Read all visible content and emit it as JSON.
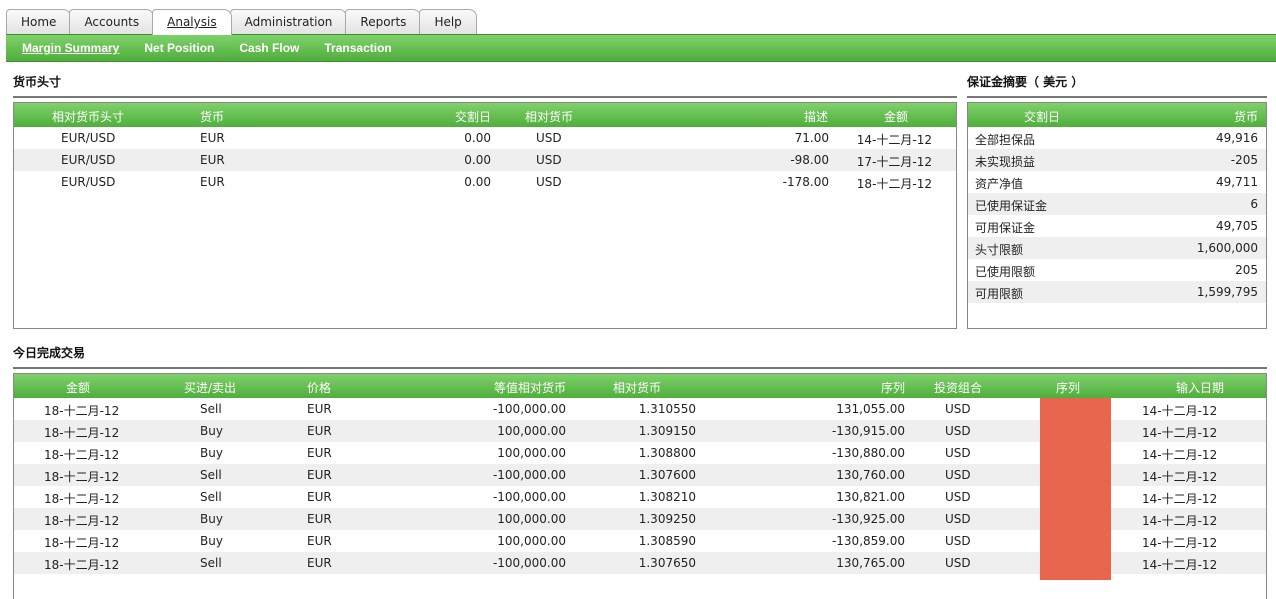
{
  "nav": {
    "tabs": [
      "Home",
      "Accounts",
      "Analysis",
      "Administration",
      "Reports",
      "Help"
    ],
    "active_tab": "Analysis",
    "subtabs": [
      "Margin Summary",
      "Net Position",
      "Cash Flow",
      "Transaction"
    ],
    "active_subtab": "Margin Summary"
  },
  "positions": {
    "title": "货币头寸",
    "headers": [
      "相对货币头寸",
      "货币",
      "交割日",
      "相对货币",
      "描述",
      "金额"
    ],
    "rows": [
      [
        "EUR/USD",
        "EUR",
        "0.00",
        "USD",
        "71.00",
        "14-十二月-12"
      ],
      [
        "EUR/USD",
        "EUR",
        "0.00",
        "USD",
        "-98.00",
        "17-十二月-12"
      ],
      [
        "EUR/USD",
        "EUR",
        "0.00",
        "USD",
        "-178.00",
        "18-十二月-12"
      ]
    ]
  },
  "summary": {
    "title": "保证金摘要（ 美元 ）",
    "headers": [
      "交割日",
      "货币"
    ],
    "rows": [
      [
        "全部担保品",
        "49,916"
      ],
      [
        "未实现损益",
        "-205"
      ],
      [
        "资产净值",
        "49,711"
      ],
      [
        "已使用保证金",
        "6"
      ],
      [
        "可用保证金",
        "49,705"
      ],
      [
        "头寸限额",
        "1,600,000"
      ],
      [
        "已使用限额",
        "205"
      ],
      [
        "可用限额",
        "1,599,795"
      ]
    ]
  },
  "trades": {
    "title": "今日完成交易",
    "headers": [
      "金额",
      "买进/卖出",
      "价格",
      "等值相对货币",
      "相对货币",
      "序列",
      "投资组合",
      "序列",
      "输入日期"
    ],
    "rows": [
      [
        "18-十二月-12",
        "Sell",
        "EUR",
        "-100,000.00",
        "1.310550",
        "131,055.00",
        "USD",
        "14-十二月-12"
      ],
      [
        "18-十二月-12",
        "Buy",
        "EUR",
        "100,000.00",
        "1.309150",
        "-130,915.00",
        "USD",
        "14-十二月-12"
      ],
      [
        "18-十二月-12",
        "Buy",
        "EUR",
        "100,000.00",
        "1.308800",
        "-130,880.00",
        "USD",
        "14-十二月-12"
      ],
      [
        "18-十二月-12",
        "Sell",
        "EUR",
        "-100,000.00",
        "1.307600",
        "130,760.00",
        "USD",
        "14-十二月-12"
      ],
      [
        "18-十二月-12",
        "Sell",
        "EUR",
        "-100,000.00",
        "1.308210",
        "130,821.00",
        "USD",
        "14-十二月-12"
      ],
      [
        "18-十二月-12",
        "Buy",
        "EUR",
        "100,000.00",
        "1.309250",
        "-130,925.00",
        "USD",
        "14-十二月-12"
      ],
      [
        "18-十二月-12",
        "Buy",
        "EUR",
        "100,000.00",
        "1.308590",
        "-130,859.00",
        "USD",
        "14-十二月-12"
      ],
      [
        "18-十二月-12",
        "Sell",
        "EUR",
        "-100,000.00",
        "1.307650",
        "130,765.00",
        "USD",
        "14-十二月-12"
      ]
    ]
  },
  "colors": {
    "accent_green": "#5cb947",
    "redaction": "#e8654e"
  }
}
